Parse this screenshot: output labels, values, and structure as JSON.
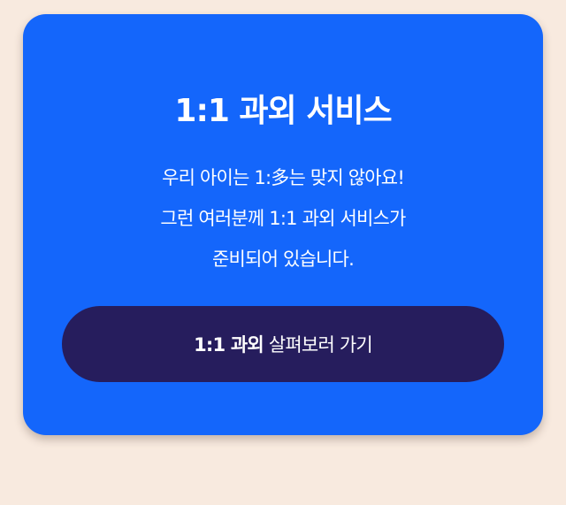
{
  "card": {
    "title": "1:1 과외 서비스",
    "description_lines": [
      "우리 아이는 1:多는 맞지 않아요!",
      "그런 여러분께 1:1 과외 서비스가",
      "준비되어 있습니다."
    ],
    "cta": {
      "strong": "1:1 과외",
      "rest": "살펴보러 가기"
    }
  },
  "colors": {
    "background": "#f8eadf",
    "card": "#1466fb",
    "button": "#261d5d",
    "text": "#ffffff"
  }
}
